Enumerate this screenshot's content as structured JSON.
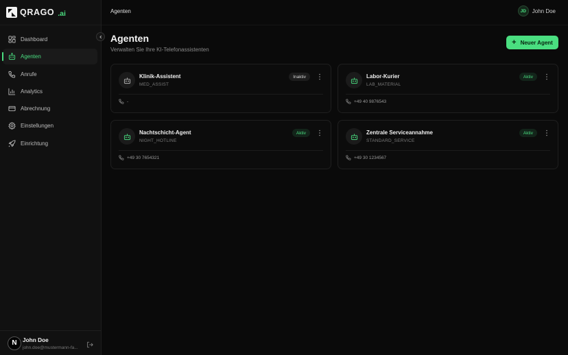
{
  "brand": {
    "name": "QRAGO",
    "suffix": ".ai"
  },
  "sidebar": {
    "items": [
      {
        "label": "Dashboard",
        "icon": "grid-icon"
      },
      {
        "label": "Agenten",
        "icon": "robot-icon",
        "active": true
      },
      {
        "label": "Anrufe",
        "icon": "phone-icon"
      },
      {
        "label": "Analytics",
        "icon": "bar-chart-icon"
      },
      {
        "label": "Abrechnung",
        "icon": "credit-card-icon"
      },
      {
        "label": "Einstellungen",
        "icon": "gear-icon"
      },
      {
        "label": "Einrichtung",
        "icon": "rocket-icon"
      }
    ]
  },
  "user": {
    "name": "John Doe",
    "email": "john.doe@mustermann-fa...",
    "initials": "JD",
    "avatar_letter": "N"
  },
  "header": {
    "breadcrumb": "Agenten"
  },
  "page": {
    "title": "Agenten",
    "subtitle": "Verwalten Sie Ihre KI-Telefonassistenten",
    "new_button": "Neuer Agent"
  },
  "agents": [
    {
      "name": "Klinik-Assistent",
      "code": "MED_ASSIST",
      "status": "Inaktiv",
      "phone": "-"
    },
    {
      "name": "Labor-Kurier",
      "code": "LAB_MATERIAL",
      "status": "Aktiv",
      "phone": "+49 40 9876543"
    },
    {
      "name": "Nachtschicht-Agent",
      "code": "NIGHT_HOTLINE",
      "status": "Aktiv",
      "phone": "+49 30 7654321"
    },
    {
      "name": "Zentrale Serviceannahme",
      "code": "STANDARD_SERVICE",
      "status": "Aktiv",
      "phone": "+49 30 1234567"
    }
  ],
  "colors": {
    "accent": "#4ade80",
    "background": "#0a0a0a",
    "sidebar": "#111111"
  }
}
